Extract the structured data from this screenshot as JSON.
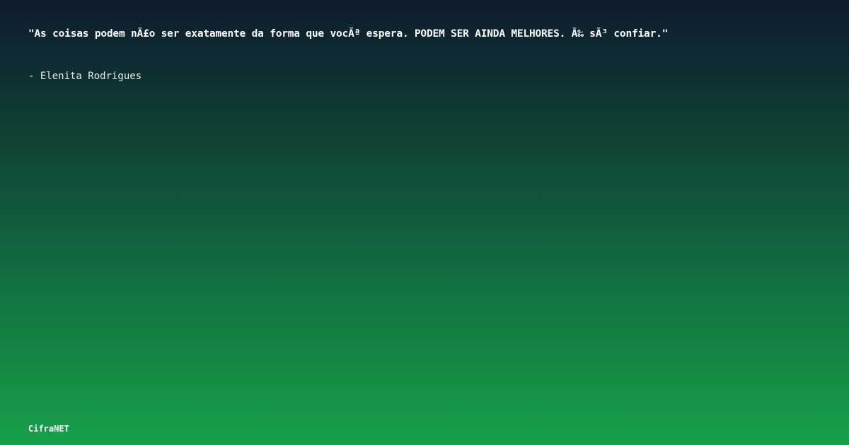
{
  "quote": {
    "text": "\"As coisas podem nÃ£o ser exatamente da forma que vocÃª espera. PODEM SER AINDA MELHORES. Ã‰ sÃ³ confiar.\""
  },
  "author": {
    "text": "- Elenita Rodrigues"
  },
  "brand": {
    "name": "CifraNET"
  },
  "colors": {
    "gradient_top": "#0d1b2e",
    "gradient_bottom": "#16a149",
    "text": "#ffffff"
  }
}
